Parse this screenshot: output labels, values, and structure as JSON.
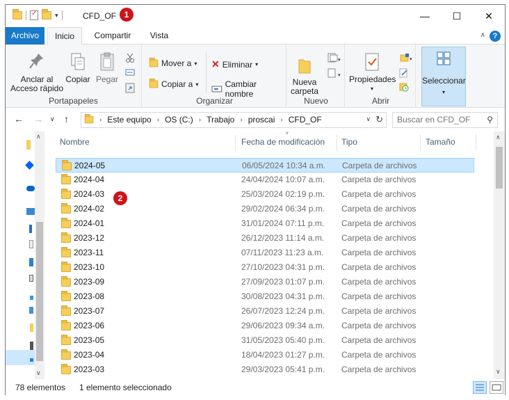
{
  "window": {
    "title": "CFD_OF",
    "badges": [
      "1",
      "2"
    ]
  },
  "ribbon_tabs": [
    "Archivo",
    "Inicio",
    "Compartir",
    "Vista"
  ],
  "ribbon": {
    "portapapeles": {
      "anclar_line1": "Anclar al",
      "anclar_line2": "Acceso rápido",
      "copiar": "Copiar",
      "pegar": "Pegar",
      "label": "Portapapeles"
    },
    "organizar": {
      "mover": "Mover a",
      "copiar_a": "Copiar a",
      "eliminar": "Eliminar",
      "cambiar": "Cambiar nombre",
      "label": "Organizar"
    },
    "nuevo": {
      "nueva_line1": "Nueva",
      "nueva_line2": "carpeta",
      "label": "Nuevo"
    },
    "abrir": {
      "propiedades": "Propiedades",
      "label": "Abrir"
    },
    "seleccionar": {
      "label": "Seleccionar"
    }
  },
  "address": {
    "crumbs": [
      "Este equipo",
      "OS (C:)",
      "Trabajo",
      "proscai",
      "CFD_OF"
    ],
    "search_placeholder": "Buscar en CFD_OF"
  },
  "columns": {
    "name": "Nombre",
    "date": "Fecha de modificación",
    "type": "Tipo",
    "size": "Tamaño"
  },
  "files": [
    {
      "name": "2024-05",
      "date": "06/05/2024 10:34 a.m.",
      "type": "Carpeta de archivos",
      "selected": true
    },
    {
      "name": "2024-04",
      "date": "24/04/2024 10:07 a.m.",
      "type": "Carpeta de archivos"
    },
    {
      "name": "2024-03",
      "date": "25/03/2024 02:19 p.m.",
      "type": "Carpeta de archivos"
    },
    {
      "name": "2024-02",
      "date": "29/02/2024 06:34 p.m.",
      "type": "Carpeta de archivos"
    },
    {
      "name": "2024-01",
      "date": "31/01/2024 07:11 p.m.",
      "type": "Carpeta de archivos"
    },
    {
      "name": "2023-12",
      "date": "26/12/2023 11:14 a.m.",
      "type": "Carpeta de archivos"
    },
    {
      "name": "2023-11",
      "date": "07/11/2023 11:23 a.m.",
      "type": "Carpeta de archivos"
    },
    {
      "name": "2023-10",
      "date": "27/10/2023 04:31 p.m.",
      "type": "Carpeta de archivos"
    },
    {
      "name": "2023-09",
      "date": "27/09/2023 01:07 p.m.",
      "type": "Carpeta de archivos"
    },
    {
      "name": "2023-08",
      "date": "30/08/2023 04:31 p.m.",
      "type": "Carpeta de archivos"
    },
    {
      "name": "2023-07",
      "date": "26/07/2023 12:24 p.m.",
      "type": "Carpeta de archivos"
    },
    {
      "name": "2023-06",
      "date": "29/06/2023 09:34 a.m.",
      "type": "Carpeta de archivos"
    },
    {
      "name": "2023-05",
      "date": "31/05/2023 05:40 p.m.",
      "type": "Carpeta de archivos"
    },
    {
      "name": "2023-04",
      "date": "18/04/2023 01:27 p.m.",
      "type": "Carpeta de archivos"
    },
    {
      "name": "2023-03",
      "date": "29/03/2023 05:41 p.m.",
      "type": "Carpeta de archivos"
    }
  ],
  "status": {
    "count": "78 elementos",
    "selection": "1 elemento seleccionado"
  },
  "colors": {
    "accent": "#1979ca",
    "selection": "#cce8ff",
    "folder": "#f6cf5a",
    "badge": "#d0121b"
  }
}
